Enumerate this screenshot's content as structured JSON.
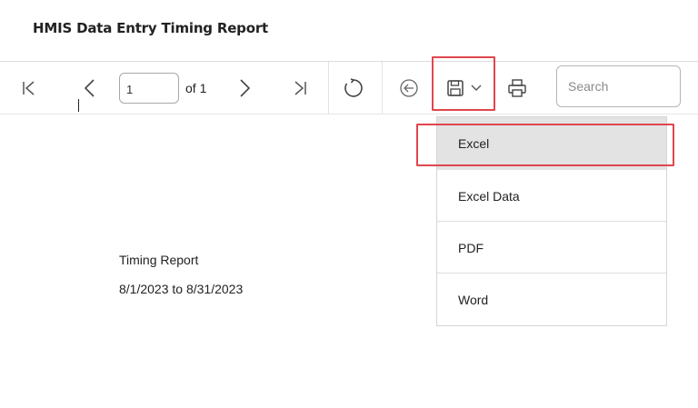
{
  "header": {
    "title": "HMIS Data Entry Timing Report"
  },
  "toolbar": {
    "page_value": "1",
    "of_label": "of 1",
    "search_placeholder": "Search",
    "icons": {
      "first": "first-page-icon",
      "prev": "previous-page-icon",
      "next": "next-page-icon",
      "last": "last-page-icon",
      "refresh": "refresh-icon",
      "back": "back-icon",
      "save": "save-icon",
      "save_menu": "chevron-down-icon",
      "print": "print-icon"
    }
  },
  "export_menu": {
    "items": [
      {
        "label": "Excel"
      },
      {
        "label": "Excel Data"
      },
      {
        "label": "PDF"
      },
      {
        "label": "Word"
      }
    ]
  },
  "report": {
    "title": "Timing Report",
    "date_range": "8/1/2023 to 8/31/2023"
  },
  "colors": {
    "highlight": "#e0474c",
    "icon": "#555555",
    "active_item": "#e3e3e3"
  }
}
